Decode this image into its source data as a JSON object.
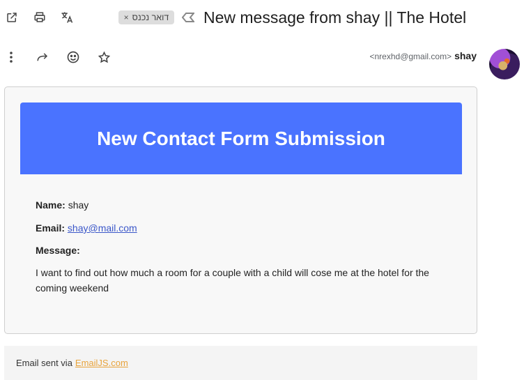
{
  "header": {
    "label_chip": "דואר נכנס",
    "label_remove": "×",
    "subject": "New message from shay || The Hotel"
  },
  "toolbar_icons": [
    "open-in-new-window-icon",
    "print-icon",
    "translate-icon",
    "important-marker-icon",
    "more-vertical-icon",
    "forward-icon",
    "emoji-icon",
    "star-icon"
  ],
  "sender": {
    "email": "<nrexhd@gmail.com>",
    "name": "shay"
  },
  "email_body": {
    "banner_title": "New Contact Form Submission",
    "banner_color": "#4a73ff",
    "name_label": "Name:",
    "name_value": "shay",
    "email_label": "Email:",
    "email_value": "shay@mail.com",
    "message_label": "Message:",
    "message_text": "I want to find out how much a room for a couple with a child will cose me at the hotel for the coming weekend"
  },
  "footer": {
    "prefix": "Email sent via",
    "link": "EmailJS.com",
    "link_color": "#e8a33b"
  }
}
